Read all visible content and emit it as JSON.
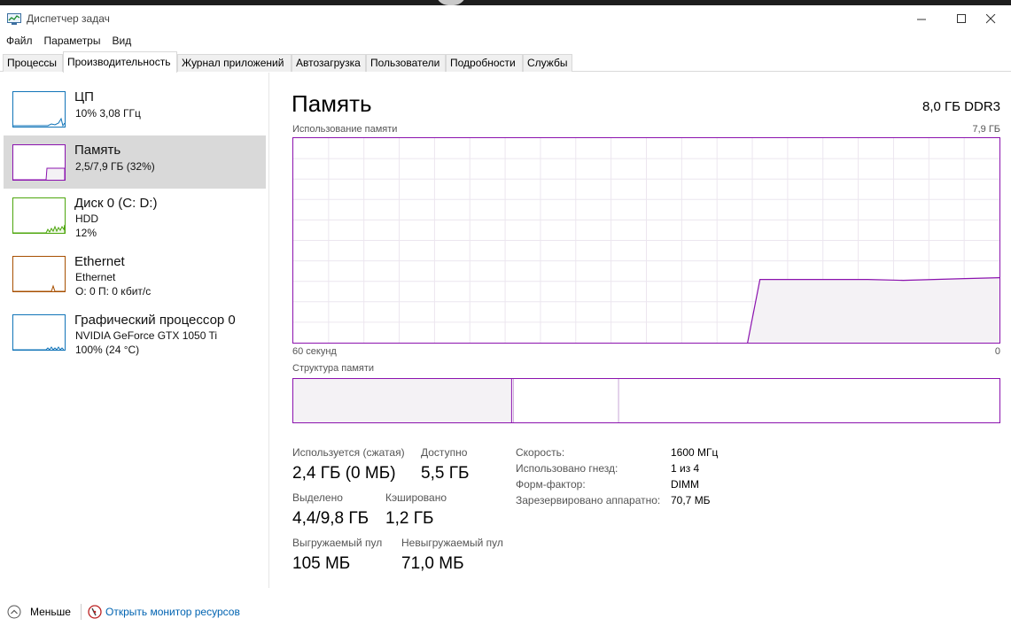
{
  "window": {
    "title": "Диспетчер задач",
    "icons": [
      "task-manager-app-icon",
      "minimize-icon",
      "maximize-icon",
      "close-icon"
    ]
  },
  "menu": [
    "Файл",
    "Параметры",
    "Вид"
  ],
  "tabs": [
    {
      "label": "Процессы"
    },
    {
      "label": "Производительность",
      "active": true
    },
    {
      "label": "Журнал приложений"
    },
    {
      "label": "Автозагрузка"
    },
    {
      "label": "Пользователи"
    },
    {
      "label": "Подробности"
    },
    {
      "label": "Службы"
    }
  ],
  "sidebar": {
    "items": [
      {
        "name": "ЦП",
        "sub1": "10% 3,08 ГГц",
        "sub2": "",
        "color": "#1174b8"
      },
      {
        "name": "Память",
        "sub1": "2,5/7,9 ГБ (32%)",
        "sub2": "",
        "color": "#8b12ae",
        "selected": true
      },
      {
        "name": "Диск 0 (C: D:)",
        "sub1": "HDD",
        "sub2": "12%",
        "color": "#4da60c"
      },
      {
        "name": "Ethernet",
        "sub1": "Ethernet",
        "sub2": "О: 0 П: 0 кбит/с",
        "color": "#a74f01"
      },
      {
        "name": "Графический процессор 0",
        "sub1": "NVIDIA GeForce GTX 1050 Ti",
        "sub2": "100% (24 °C)",
        "color": "#1174b8"
      }
    ]
  },
  "memory": {
    "title": "Память",
    "spec": "8,0 ГБ DDR3",
    "usage_label": "Использование памяти",
    "usage_max": "7,9 ГБ",
    "time_left": "60 секунд",
    "time_right": "0",
    "structure_label": "Структура памяти",
    "accent_color": "#8b12ae",
    "fill_color": "#f4f2f5",
    "stats": {
      "in_use_label": "Используется (сжатая)",
      "in_use_value": "2,4 ГБ (0 МБ)",
      "available_label": "Доступно",
      "available_value": "5,5 ГБ",
      "committed_label": "Выделено",
      "committed_value": "4,4/9,8 ГБ",
      "cached_label": "Кэшировано",
      "cached_value": "1,2 ГБ",
      "paged_label": "Выгружаемый пул",
      "paged_value": "105 МБ",
      "nonpaged_label": "Невыгружаемый пул",
      "nonpaged_value": "71,0 МБ"
    },
    "specs": [
      {
        "label": "Скорость:",
        "value": "1600 МГц"
      },
      {
        "label": "Использовано гнезд:",
        "value": "1 из 4"
      },
      {
        "label": "Форм-фактор:",
        "value": "DIMM"
      },
      {
        "label": "Зарезервировано аппаратно:",
        "value": "70,7 МБ"
      }
    ]
  },
  "footer": {
    "less": "Меньше",
    "resource_monitor": "Открыть монитор ресурсов",
    "link_color": "#0063b1"
  }
}
